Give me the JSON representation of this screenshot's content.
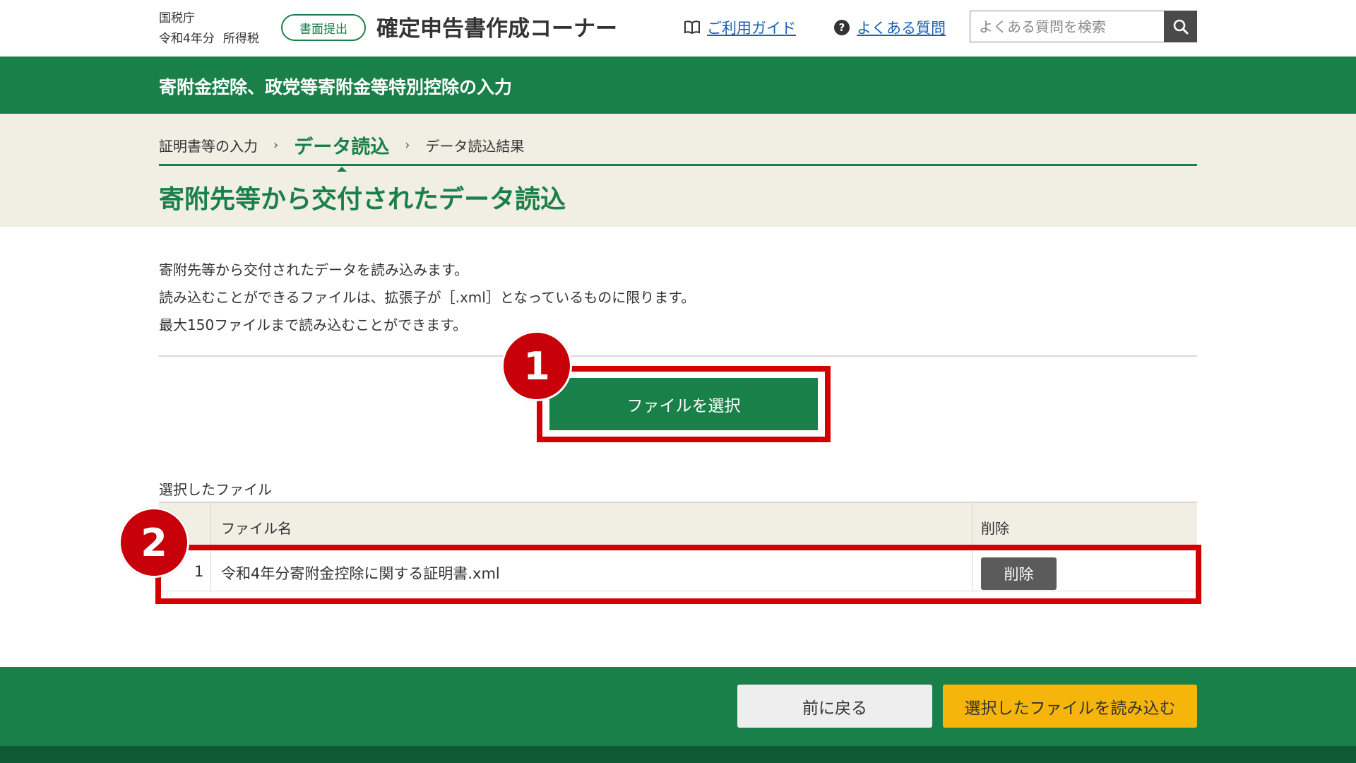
{
  "header": {
    "agency": "国税庁",
    "year": "令和4年分",
    "tax_type": "所得税",
    "submit_badge": "書面提出",
    "site_title": "確定申告書作成コーナー",
    "guide_link": "ご利用ガイド",
    "faq_link": "よくある質問",
    "search_placeholder": "よくある質問を検索",
    "icons": [
      "book-icon",
      "question-icon",
      "search-icon"
    ]
  },
  "section_title": "寄附金控除、政党等寄附金等特別控除の入力",
  "steps": [
    {
      "label": "証明書等の入力",
      "active": false
    },
    {
      "label": "データ読込",
      "active": true
    },
    {
      "label": "データ読込結果",
      "active": false
    }
  ],
  "page_title": "寄附先等から交付されたデータ読込",
  "description": [
    "寄附先等から交付されたデータを読み込みます。",
    "読み込むことができるファイルは、拡張子が［.xml］となっているものに限ります。",
    "最大150ファイルまで読み込むことができます。"
  ],
  "select_file_button": "ファイルを選択",
  "annotations": [
    "1",
    "2"
  ],
  "table": {
    "caption": "選択したファイル",
    "headers": [
      "ファイル名",
      "削除"
    ],
    "rows": [
      {
        "num": "1",
        "name": "令和4年分寄附金控除に関する証明書.xml",
        "action": "削除"
      }
    ]
  },
  "buttons": {
    "back": "前に戻る",
    "load": "選択したファイルを読み込む"
  },
  "colors": {
    "brand_green": "#1a8049",
    "beige": "#f1eee3",
    "highlight_red": "#d40000",
    "load_yellow": "#f5b50a"
  }
}
